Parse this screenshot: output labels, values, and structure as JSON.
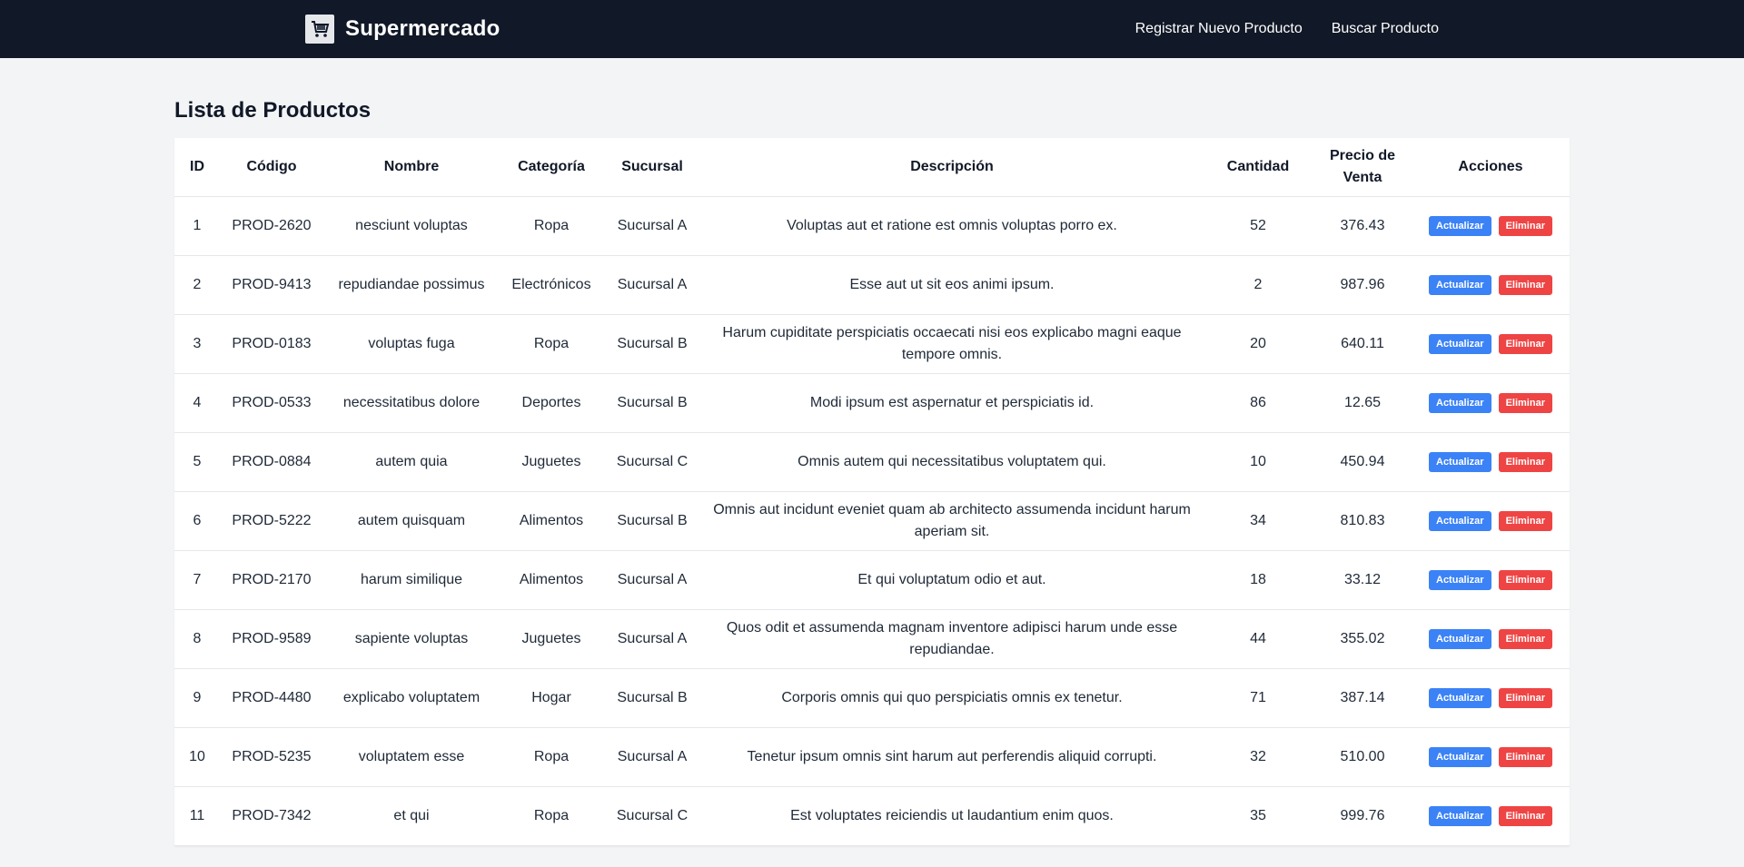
{
  "app": {
    "name": "Supermercado",
    "logo_icon": "shopping-cart-icon"
  },
  "nav": {
    "register_label": "Registrar Nuevo Producto",
    "search_label": "Buscar Producto"
  },
  "page": {
    "title": "Lista de Productos"
  },
  "table": {
    "headers": {
      "id": "ID",
      "code": "Código",
      "name": "Nombre",
      "category": "Categoría",
      "branch": "Sucursal",
      "description": "Descripción",
      "quantity": "Cantidad",
      "price": "Precio de Venta",
      "actions": "Acciones"
    },
    "update_label": "Actualizar",
    "delete_label": "Eliminar",
    "rows": [
      {
        "id": "1",
        "code": "PROD-2620",
        "name": "nesciunt voluptas",
        "category": "Ropa",
        "branch": "Sucursal A",
        "description": "Voluptas aut et ratione est omnis voluptas porro ex.",
        "quantity": "52",
        "price": "376.43"
      },
      {
        "id": "2",
        "code": "PROD-9413",
        "name": "repudiandae possimus",
        "category": "Electrónicos",
        "branch": "Sucursal A",
        "description": "Esse aut ut sit eos animi ipsum.",
        "quantity": "2",
        "price": "987.96"
      },
      {
        "id": "3",
        "code": "PROD-0183",
        "name": "voluptas fuga",
        "category": "Ropa",
        "branch": "Sucursal B",
        "description": "Harum cupiditate perspiciatis occaecati nisi eos explicabo magni eaque tempore omnis.",
        "quantity": "20",
        "price": "640.11"
      },
      {
        "id": "4",
        "code": "PROD-0533",
        "name": "necessitatibus dolore",
        "category": "Deportes",
        "branch": "Sucursal B",
        "description": "Modi ipsum est aspernatur et perspiciatis id.",
        "quantity": "86",
        "price": "12.65"
      },
      {
        "id": "5",
        "code": "PROD-0884",
        "name": "autem quia",
        "category": "Juguetes",
        "branch": "Sucursal C",
        "description": "Omnis autem qui necessitatibus voluptatem qui.",
        "quantity": "10",
        "price": "450.94"
      },
      {
        "id": "6",
        "code": "PROD-5222",
        "name": "autem quisquam",
        "category": "Alimentos",
        "branch": "Sucursal B",
        "description": "Omnis aut incidunt eveniet quam ab architecto assumenda incidunt harum aperiam sit.",
        "quantity": "34",
        "price": "810.83"
      },
      {
        "id": "7",
        "code": "PROD-2170",
        "name": "harum similique",
        "category": "Alimentos",
        "branch": "Sucursal A",
        "description": "Et qui voluptatum odio et aut.",
        "quantity": "18",
        "price": "33.12"
      },
      {
        "id": "8",
        "code": "PROD-9589",
        "name": "sapiente voluptas",
        "category": "Juguetes",
        "branch": "Sucursal A",
        "description": "Quos odit et assumenda magnam inventore adipisci harum unde esse repudiandae.",
        "quantity": "44",
        "price": "355.02"
      },
      {
        "id": "9",
        "code": "PROD-4480",
        "name": "explicabo voluptatem",
        "category": "Hogar",
        "branch": "Sucursal B",
        "description": "Corporis omnis qui quo perspiciatis omnis ex tenetur.",
        "quantity": "71",
        "price": "387.14"
      },
      {
        "id": "10",
        "code": "PROD-5235",
        "name": "voluptatem esse",
        "category": "Ropa",
        "branch": "Sucursal A",
        "description": "Tenetur ipsum omnis sint harum aut perferendis aliquid corrupti.",
        "quantity": "32",
        "price": "510.00"
      },
      {
        "id": "11",
        "code": "PROD-7342",
        "name": "et qui",
        "category": "Ropa",
        "branch": "Sucursal C",
        "description": "Est voluptates reiciendis ut laudantium enim quos.",
        "quantity": "35",
        "price": "999.76"
      }
    ]
  }
}
